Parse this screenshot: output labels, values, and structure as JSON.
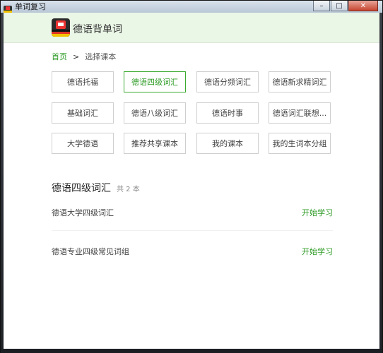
{
  "window": {
    "title": "单词复习"
  },
  "header": {
    "app_name": "德语背单词"
  },
  "breadcrumb": {
    "home": "首页",
    "separator": ">",
    "current": "选择课本"
  },
  "categories": [
    {
      "label": "德语托福"
    },
    {
      "label": "德语四级词汇",
      "active": true
    },
    {
      "label": "德语分频词汇"
    },
    {
      "label": "德语新求精词汇"
    },
    {
      "label": "基础词汇"
    },
    {
      "label": "德语八级词汇"
    },
    {
      "label": "德语时事"
    },
    {
      "label": "德语词汇联想..."
    },
    {
      "label": "大学德语"
    },
    {
      "label": "推荐共享课本"
    },
    {
      "label": "我的课本"
    },
    {
      "label": "我的生词本分组"
    }
  ],
  "section": {
    "title": "德语四级词汇",
    "count": "共 2 本",
    "books": [
      {
        "name": "德语大学四级词汇",
        "action": "开始学习"
      },
      {
        "name": "德语专业四级常见词组",
        "action": "开始学习"
      }
    ]
  },
  "colors": {
    "accent": "#2b9a22",
    "header_bg": "#eaf6e6",
    "border": "#cfcfcf"
  }
}
